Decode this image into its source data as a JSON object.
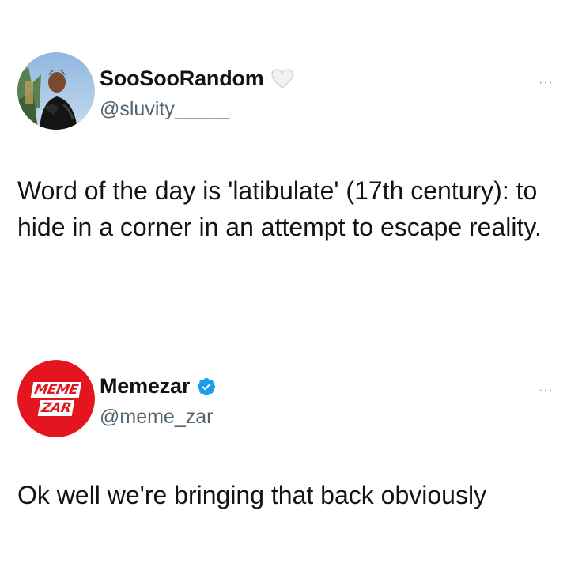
{
  "tweets": [
    {
      "display_name": "SooSooRandom",
      "handle": "@sluvity_____",
      "name_icon": "white-heart-icon",
      "more_label": "···",
      "text": "Word of the day is 'latibulate' (17th century): to hide in a corner in an attempt to escape reality."
    },
    {
      "display_name": "Memezar",
      "handle": "@meme_zar",
      "name_icon": "verified-badge-icon",
      "logo_text_top": "MEME",
      "logo_text_bottom": "ZAR",
      "more_label": "···",
      "text": "Ok well we're bringing that back obviously"
    }
  ],
  "colors": {
    "text_primary": "#0f1419",
    "text_secondary": "#536471",
    "verified_blue": "#1d9bf0",
    "logo_red": "#e4151f"
  }
}
